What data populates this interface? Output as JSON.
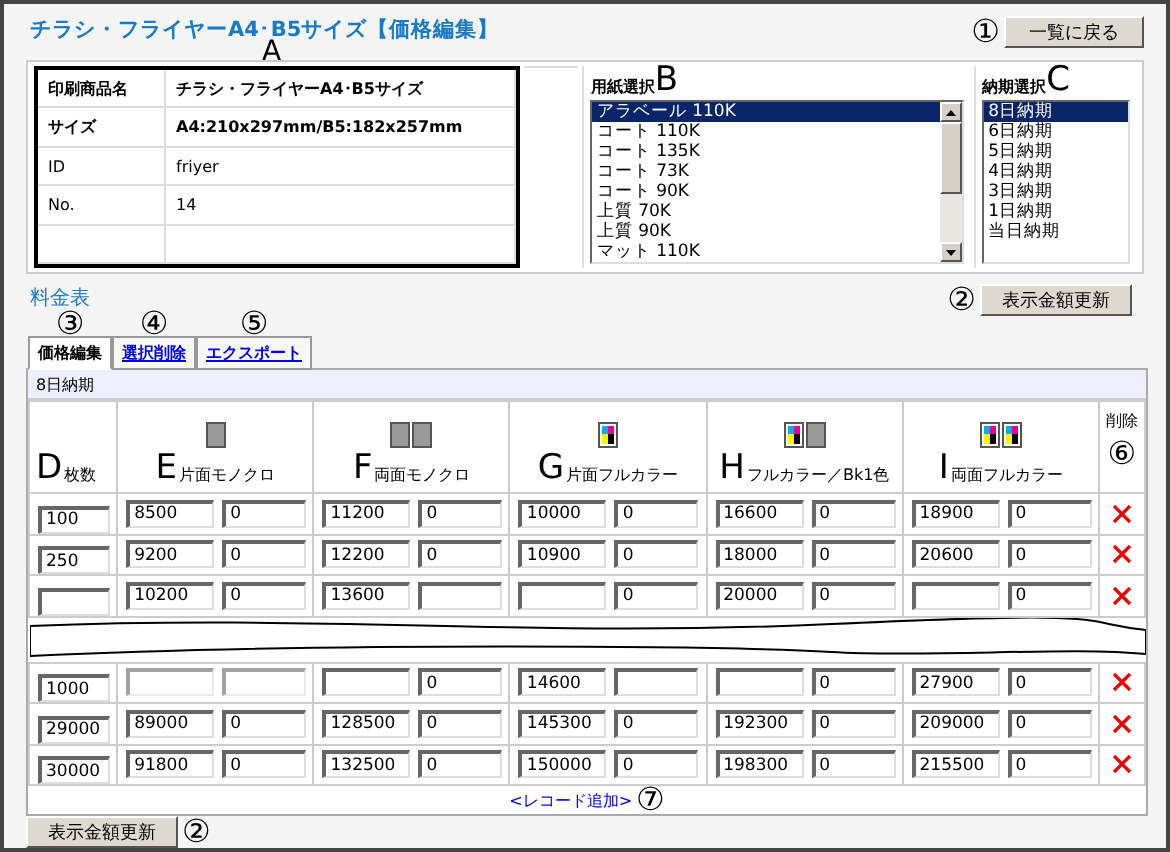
{
  "title": "チラシ・フライヤーA4･B5サイズ【価格編集】",
  "back_button": {
    "label": "一覧に戻る",
    "marker": "①"
  },
  "product_table": {
    "marker": "A",
    "rows": [
      {
        "label": "印刷商品名",
        "value": "チラシ・フライヤーA4･B5サイズ",
        "bold": true
      },
      {
        "label": "サイズ",
        "value": "A4:210x297mm/B5:182x257mm",
        "bold": true
      },
      {
        "label": "ID",
        "value": "friyer",
        "bold": false
      },
      {
        "label": "No.",
        "value": "14",
        "bold": false
      }
    ]
  },
  "paper_select": {
    "label": "用紙選択",
    "marker": "B",
    "options": [
      {
        "label": "アラベール 110K",
        "selected": true
      },
      {
        "label": "コート 110K",
        "selected": false
      },
      {
        "label": "コート 135K",
        "selected": false
      },
      {
        "label": "コート 73K",
        "selected": false
      },
      {
        "label": "コート 90K",
        "selected": false
      },
      {
        "label": "上質 70K",
        "selected": false
      },
      {
        "label": "上質 90K",
        "selected": false
      },
      {
        "label": "マット 110K",
        "selected": false
      }
    ]
  },
  "delivery_select": {
    "label": "納期選択",
    "marker": "C",
    "options": [
      {
        "label": "8日納期",
        "selected": true
      },
      {
        "label": "6日納期",
        "selected": false
      },
      {
        "label": "5日納期",
        "selected": false
      },
      {
        "label": "4日納期",
        "selected": false
      },
      {
        "label": "3日納期",
        "selected": false
      },
      {
        "label": "1日納期",
        "selected": false
      },
      {
        "label": "当日納期",
        "selected": false
      }
    ]
  },
  "section_title": "料金表",
  "top_update_button": {
    "label": "表示金額更新",
    "marker": "②"
  },
  "tabs": [
    {
      "label": "価格編集",
      "marker": "③",
      "selected": true
    },
    {
      "label": "選択削除",
      "marker": "④",
      "selected": false
    },
    {
      "label": "エクスポート",
      "marker": "⑤",
      "selected": false
    }
  ],
  "delivery_label": "8日納期",
  "columns": [
    {
      "kind": "qty",
      "marker": "D",
      "label": "枚数"
    },
    {
      "kind": "price",
      "marker": "E",
      "label": "片面モノクロ",
      "icons": [
        {
          "kind": "mono"
        }
      ]
    },
    {
      "kind": "price",
      "marker": "F",
      "label": "両面モノクロ",
      "icons": [
        {
          "kind": "mono"
        },
        {
          "kind": "mono"
        }
      ]
    },
    {
      "kind": "price",
      "marker": "G",
      "label": "片面フルカラー",
      "icons": [
        {
          "kind": "color"
        }
      ]
    },
    {
      "kind": "price",
      "marker": "H",
      "label": "フルカラー／Bk1色",
      "icons": [
        {
          "kind": "color"
        },
        {
          "kind": "mono"
        }
      ]
    },
    {
      "kind": "price",
      "marker": "I",
      "label": "両面フルカラー",
      "icons": [
        {
          "kind": "color"
        },
        {
          "kind": "color"
        }
      ]
    },
    {
      "kind": "delete",
      "label": "削除",
      "marker": "⑥"
    }
  ],
  "rows": [
    {
      "kind": "row",
      "quantity": "100",
      "prices": [
        {
          "main": "8500",
          "extra": "0"
        },
        {
          "main": "11200",
          "extra": "0"
        },
        {
          "main": "10000",
          "extra": "0"
        },
        {
          "main": "16600",
          "extra": "0"
        },
        {
          "main": "18900",
          "extra": "0"
        }
      ]
    },
    {
      "kind": "row",
      "quantity": "250",
      "prices": [
        {
          "main": "9200",
          "extra": "0"
        },
        {
          "main": "12200",
          "extra": "0"
        },
        {
          "main": "10900",
          "extra": "0"
        },
        {
          "main": "18000",
          "extra": "0"
        },
        {
          "main": "20600",
          "extra": "0"
        }
      ]
    },
    {
      "kind": "row",
      "prices": [
        {
          "main": "10200",
          "extra": "0"
        },
        {
          "main": "13600"
        },
        {
          "extra": "0"
        },
        {
          "main": "20000",
          "extra": "0"
        },
        {
          "extra": "0"
        }
      ]
    },
    {
      "kind": "break"
    },
    {
      "kind": "row",
      "quantity": "1000",
      "prices": [
        {
          "covered": true
        },
        {
          "extra": "0"
        },
        {
          "main": "14600"
        },
        {
          "extra": "0"
        },
        {
          "main": "27900",
          "extra": "0"
        }
      ]
    },
    {
      "kind": "row",
      "quantity": "29000",
      "prices": [
        {
          "main": "89000",
          "extra": "0"
        },
        {
          "main": "128500",
          "extra": "0"
        },
        {
          "main": "145300",
          "extra": "0"
        },
        {
          "main": "192300",
          "extra": "0"
        },
        {
          "main": "209000",
          "extra": "0"
        }
      ]
    },
    {
      "kind": "row",
      "quantity": "30000",
      "prices": [
        {
          "main": "91800",
          "extra": "0"
        },
        {
          "main": "132500",
          "extra": "0"
        },
        {
          "main": "150000",
          "extra": "0"
        },
        {
          "main": "198300",
          "extra": "0"
        },
        {
          "main": "215500",
          "extra": "0"
        }
      ]
    }
  ],
  "add_record": {
    "label": "<レコード追加>",
    "marker": "⑦"
  },
  "bottom_update_button": {
    "label": "表示金額更新",
    "marker": "②"
  }
}
